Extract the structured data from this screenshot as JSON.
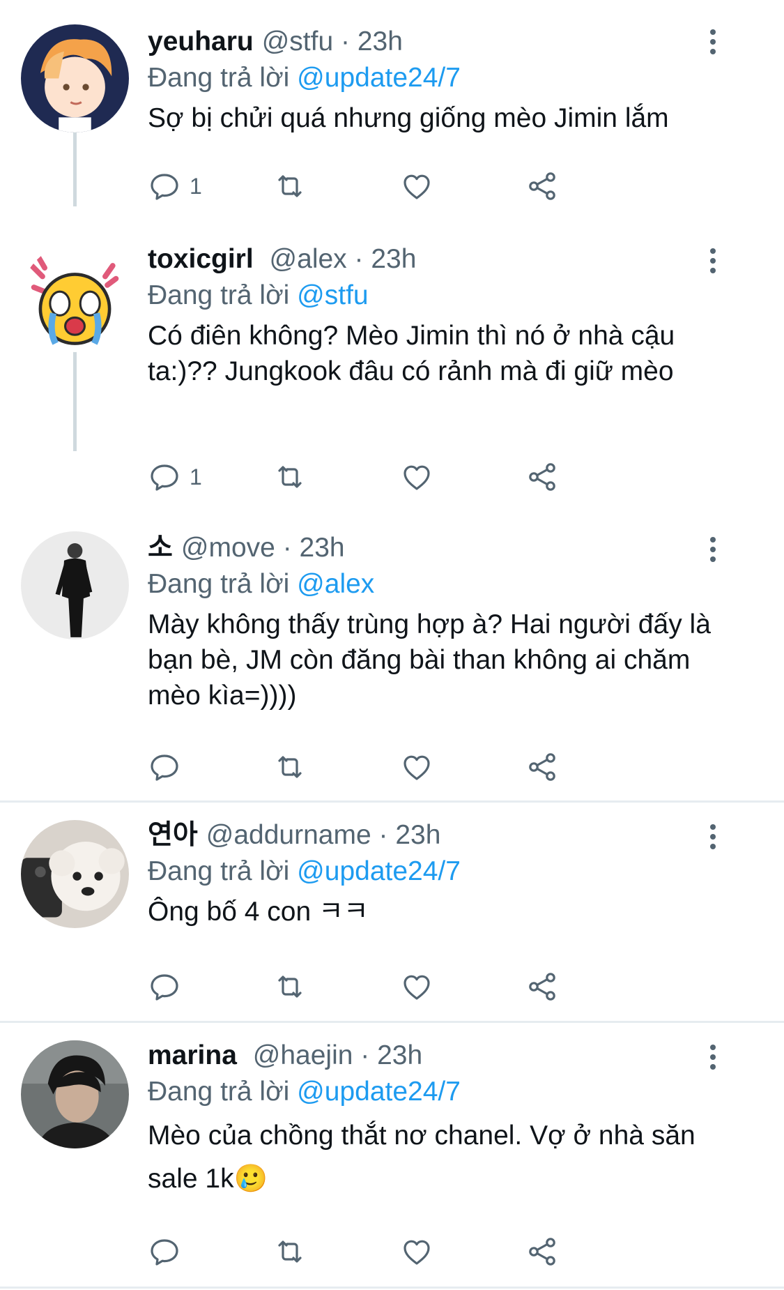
{
  "colors": {
    "accent": "#1d9bf0",
    "secondary": "#536471",
    "text": "#0f1419",
    "divider": "#e6ecf0"
  },
  "reply_prefix": "Đang trả lời",
  "tweets": [
    {
      "name": "yeuharu",
      "handle": "@stfu",
      "time": "· 23h",
      "reply_to": "@update24/7",
      "text": "Sợ bị chửi quá nhưng giống mèo Jimin lắm",
      "reply_count": "1",
      "avatar_icon": "anime-boy-avatar"
    },
    {
      "name": "toxicgirl",
      "handle": "@alex",
      "time": "· 23h",
      "reply_to": "@stfu",
      "text": "Có điên không? Mèo Jimin thì nó ở nhà cậu ta:)?? Jungkook đâu có rảnh mà đi giữ mèo",
      "reply_count": "1",
      "avatar_icon": "crying-emoji-avatar"
    },
    {
      "name": "소",
      "handle": "@move",
      "time": "· 23h",
      "reply_to": "@alex",
      "text": "Mày không thấy trùng hợp à? Hai người đấy là bạn bè, JM còn đăng bài than không ai chăm mèo kìa=))))",
      "reply_count": "",
      "avatar_icon": "man-in-black-avatar"
    },
    {
      "name": "연아",
      "handle": "@addurname",
      "time": "· 23h",
      "reply_to": "@update24/7",
      "text": "Ông bố 4 con ㅋㅋ",
      "reply_count": "",
      "avatar_icon": "white-dog-avatar"
    },
    {
      "name": "marina",
      "handle": "@haejin",
      "time": "· 23h",
      "reply_to": "@update24/7",
      "text": "Mèo của chồng thắt nơ chanel. Vợ ở nhà săn sale 1k🥲",
      "reply_count": "",
      "avatar_icon": "dark-hair-man-avatar"
    }
  ]
}
